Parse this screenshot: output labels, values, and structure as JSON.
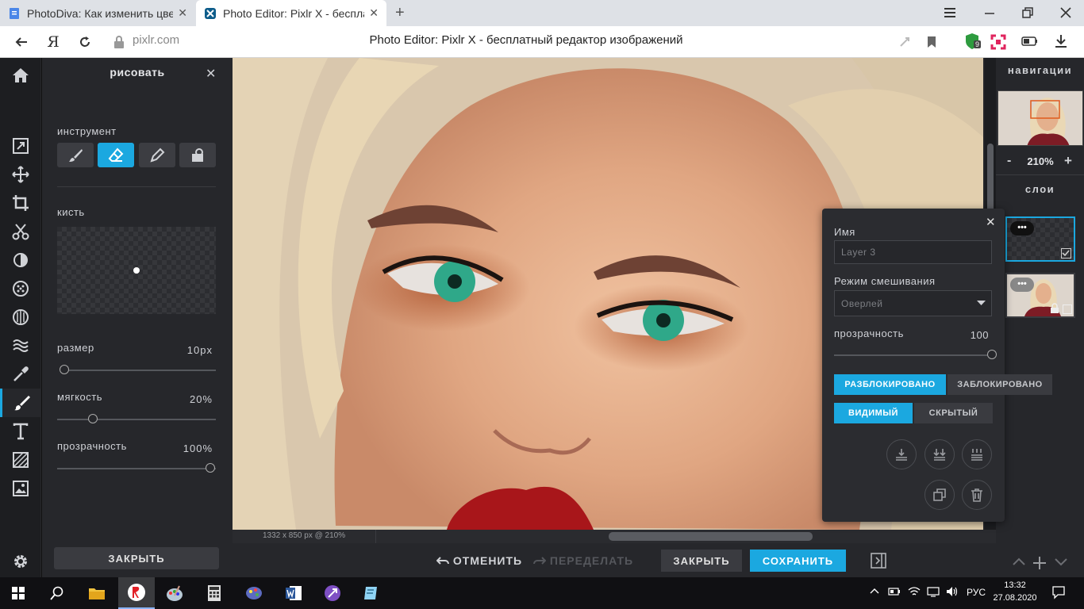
{
  "browser": {
    "tabs": [
      {
        "label": "PhotoDiva: Как изменить цве",
        "close": "✕"
      },
      {
        "label": "Photo Editor: Pixlr X - беспла",
        "close": "✕"
      }
    ],
    "new_tab": "+",
    "yandex_logo": "Я",
    "url": "pixlr.com",
    "page_title": "Photo Editor: Pixlr X - бесплатный редактор изображений",
    "extension_badge": "9"
  },
  "draw_panel": {
    "title": "рисовать",
    "close": "✕",
    "tool_label": "инструмент",
    "brush_label": "кисть",
    "size_label": "размер",
    "size_value": "10px",
    "size_level": 0.0,
    "softness_label": "мягкость",
    "softness_value": "20%",
    "softness_level": 0.2,
    "opacity_label": "прозрачность",
    "opacity_value": "100%",
    "opacity_level": 1.0,
    "close_button": "ЗАКРЫТЬ"
  },
  "canvas": {
    "status": "1332 x 850 px @ 210%"
  },
  "navigation": {
    "title": "навигации",
    "zoom_minus": "-",
    "zoom_value": "210%",
    "zoom_plus": "+",
    "layers_title": "слои"
  },
  "layer_popup": {
    "close": "✕",
    "name_label": "Имя",
    "name_value": "Layer 3",
    "blend_label": "Режим смешивания",
    "blend_value": "Оверлей",
    "opacity_label": "прозрачность",
    "opacity_value": "100",
    "opacity_level": 1.0,
    "unlocked": "РАЗБЛОКИРОВАНО",
    "locked": "ЗАБЛОКИРОВАНО",
    "visible": "ВИДИМЫЙ",
    "hidden": "СКРЫТЫЙ"
  },
  "bottom": {
    "undo": "ОТМЕНИТЬ",
    "redo": "ПЕРЕДЕЛАТЬ",
    "close": "ЗАКРЫТЬ",
    "save": "СОХРАНИТЬ"
  },
  "taskbar": {
    "language": "РУС",
    "time": "13:32",
    "date": "27.08.2020"
  },
  "colors": {
    "accent": "#1ba8e0",
    "panel_bg": "#26272b",
    "toolbar_bg": "#1d1e21"
  }
}
